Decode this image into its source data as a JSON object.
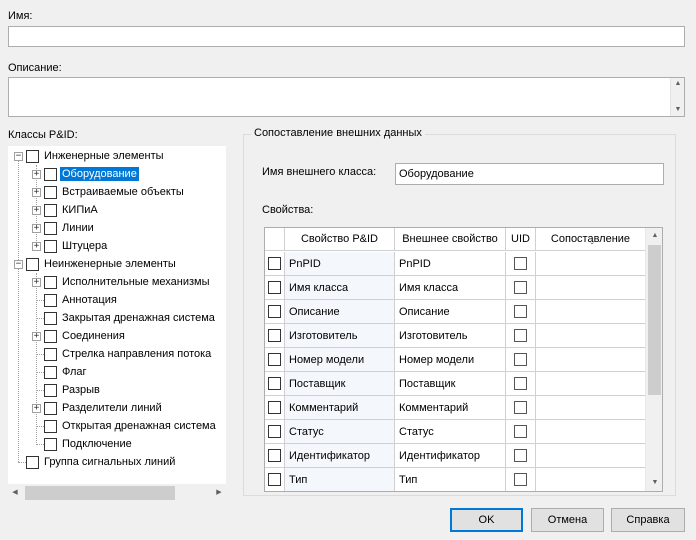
{
  "name_field": {
    "label": "Имя:",
    "value": ""
  },
  "description_field": {
    "label": "Описание:",
    "value": ""
  },
  "classes": {
    "label": "Классы P&ID:",
    "tree": [
      {
        "label": "Инженерные элементы",
        "level": 0,
        "expander": "minus",
        "checked": false
      },
      {
        "label": "Оборудование",
        "level": 1,
        "expander": "plus",
        "checked": false,
        "selected": true
      },
      {
        "label": "Встраиваемые объекты",
        "level": 1,
        "expander": "plus",
        "checked": false
      },
      {
        "label": "КИПиА",
        "level": 1,
        "expander": "plus",
        "checked": false
      },
      {
        "label": "Линии",
        "level": 1,
        "expander": "plus",
        "checked": false
      },
      {
        "label": "Штуцера",
        "level": 1,
        "expander": "plus",
        "checked": false
      },
      {
        "label": "Неинженерные элементы",
        "level": 0,
        "expander": "minus",
        "checked": false
      },
      {
        "label": "Исполнительные механизмы",
        "level": 1,
        "expander": "plus",
        "checked": false
      },
      {
        "label": "Аннотация",
        "level": 1,
        "expander": "none",
        "checked": false
      },
      {
        "label": "Закрытая дренажная система",
        "level": 1,
        "expander": "none",
        "checked": false
      },
      {
        "label": "Соединения",
        "level": 1,
        "expander": "plus",
        "checked": false
      },
      {
        "label": "Стрелка направления потока",
        "level": 1,
        "expander": "none",
        "checked": false
      },
      {
        "label": "Флаг",
        "level": 1,
        "expander": "none",
        "checked": false
      },
      {
        "label": "Разрыв",
        "level": 1,
        "expander": "none",
        "checked": false
      },
      {
        "label": "Разделители линий",
        "level": 1,
        "expander": "plus",
        "checked": false
      },
      {
        "label": "Открытая дренажная система",
        "level": 1,
        "expander": "none",
        "checked": false
      },
      {
        "label": "Подключение",
        "level": 1,
        "expander": "none",
        "checked": false
      },
      {
        "label": "Группа сигнальных линий",
        "level": 0,
        "expander": "none",
        "checked": false
      }
    ]
  },
  "mapping": {
    "title": "Сопоставление внешних данных",
    "external_class_label": "Имя внешнего класса:",
    "external_class_value": "Оборудование",
    "properties_label": "Свойства:",
    "columns": [
      "",
      "Свойство P&ID",
      "Внешнее свойство",
      "UID",
      "Сопоставление"
    ],
    "rows": [
      {
        "pid": "PnPID",
        "external": "PnPID"
      },
      {
        "pid": "Имя класса",
        "external": "Имя класса"
      },
      {
        "pid": "Описание",
        "external": "Описание"
      },
      {
        "pid": "Изготовитель",
        "external": "Изготовитель"
      },
      {
        "pid": "Номер модели",
        "external": "Номер модели"
      },
      {
        "pid": "Поставщик",
        "external": "Поставщик"
      },
      {
        "pid": "Комментарий",
        "external": "Комментарий"
      },
      {
        "pid": "Статус",
        "external": "Статус"
      },
      {
        "pid": "Идентификатор",
        "external": "Идентификатор"
      },
      {
        "pid": "Тип",
        "external": "Тип"
      }
    ]
  },
  "buttons": {
    "ok": "OK",
    "cancel": "Отмена",
    "help": "Справка"
  }
}
